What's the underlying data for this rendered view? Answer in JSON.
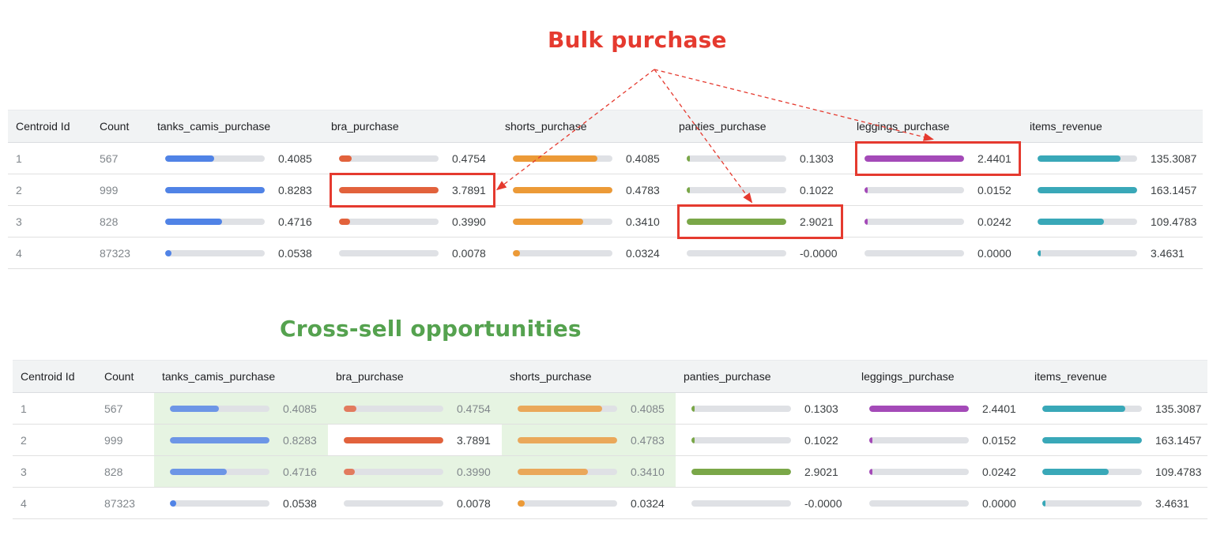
{
  "annotations": {
    "bulk_purchase": "Bulk purchase",
    "cross_sell": "Cross-sell opportunities"
  },
  "colors": {
    "tanks_camis_purchase": "#5083e6",
    "bra_purchase": "#e2623c",
    "shorts_purchase": "#ec9a37",
    "panties_purchase": "#7aa748",
    "leggings_purchase": "#a44ab8",
    "items_revenue": "#39a8b8",
    "annotation_red": "#e53a2f",
    "annotation_green": "#55a24f",
    "highlight_green": "#e6f4e2"
  },
  "columns": [
    "Centroid Id",
    "Count",
    "tanks_camis_purchase",
    "bra_purchase",
    "shorts_purchase",
    "panties_purchase",
    "leggings_purchase",
    "items_revenue"
  ],
  "rows": [
    {
      "centroid": "1",
      "count": "567",
      "values": [
        "0.4085",
        "0.4754",
        "0.4085",
        "0.1303",
        "2.4401",
        "135.3087"
      ],
      "fills": [
        0.49,
        0.13,
        0.85,
        0.03,
        1.0,
        0.83
      ]
    },
    {
      "centroid": "2",
      "count": "999",
      "values": [
        "0.8283",
        "3.7891",
        "0.4783",
        "0.1022",
        "0.0152",
        "163.1457"
      ],
      "fills": [
        1.0,
        1.0,
        1.0,
        0.02,
        0.01,
        1.0
      ]
    },
    {
      "centroid": "3",
      "count": "828",
      "values": [
        "0.4716",
        "0.3990",
        "0.3410",
        "2.9021",
        "0.0242",
        "109.4783"
      ],
      "fills": [
        0.57,
        0.11,
        0.71,
        1.0,
        0.01,
        0.67
      ]
    },
    {
      "centroid": "4",
      "count": "87323",
      "values": [
        "0.0538",
        "0.0078",
        "0.0324",
        "-0.0000",
        "0.0000",
        "3.4631"
      ],
      "fills": [
        0.06,
        0.0,
        0.07,
        0.0,
        0.0,
        0.02
      ]
    }
  ],
  "bulk_highlights": [
    {
      "row": 1,
      "col": 1
    },
    {
      "row": 2,
      "col": 3
    },
    {
      "row": 0,
      "col": 4
    }
  ],
  "cross_sell_highlights": [
    {
      "row": 0,
      "cols": [
        0,
        1,
        2
      ]
    },
    {
      "row": 1,
      "cols": [
        0,
        2
      ]
    },
    {
      "row": 2,
      "cols": [
        0,
        1,
        2
      ]
    }
  ]
}
